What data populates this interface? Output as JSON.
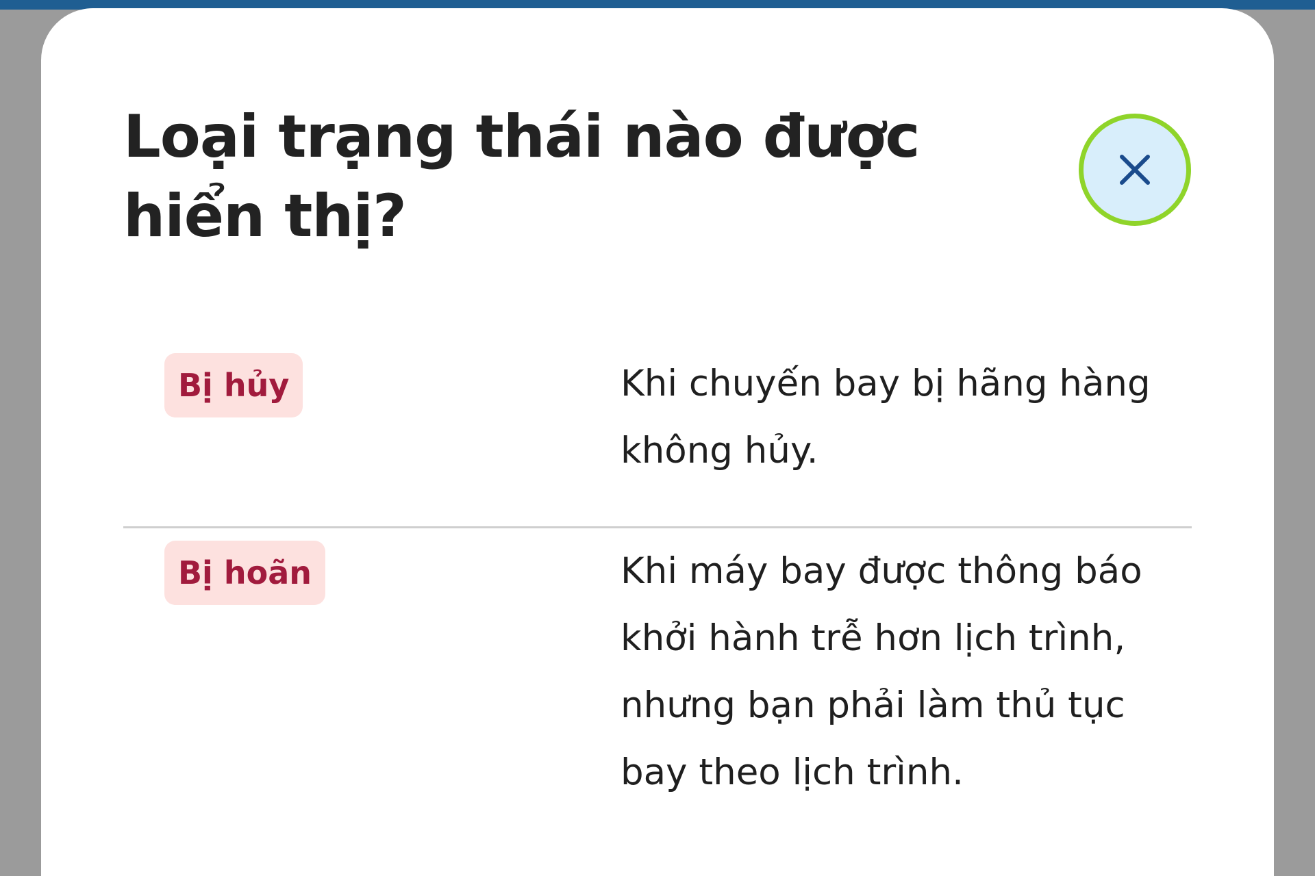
{
  "dialog": {
    "title": "Loại trạng thái nào được hiển thị?",
    "close_icon": "close-icon"
  },
  "statuses": [
    {
      "badge": "Bị hủy",
      "description": "Khi chuyến bay bị hãng hàng không hủy."
    },
    {
      "badge": "Bị hoãn",
      "description": "Khi máy bay được thông báo khởi hành trễ hơn lịch trình, nhưng bạn phải làm thủ tục bay theo lịch trình."
    }
  ],
  "colors": {
    "header_bar": "#1f5e92",
    "badge_background": "#fde1df",
    "badge_text": "#a11b3d",
    "close_button_fill": "#d8eefb",
    "close_button_ring": "#8fd42a"
  }
}
